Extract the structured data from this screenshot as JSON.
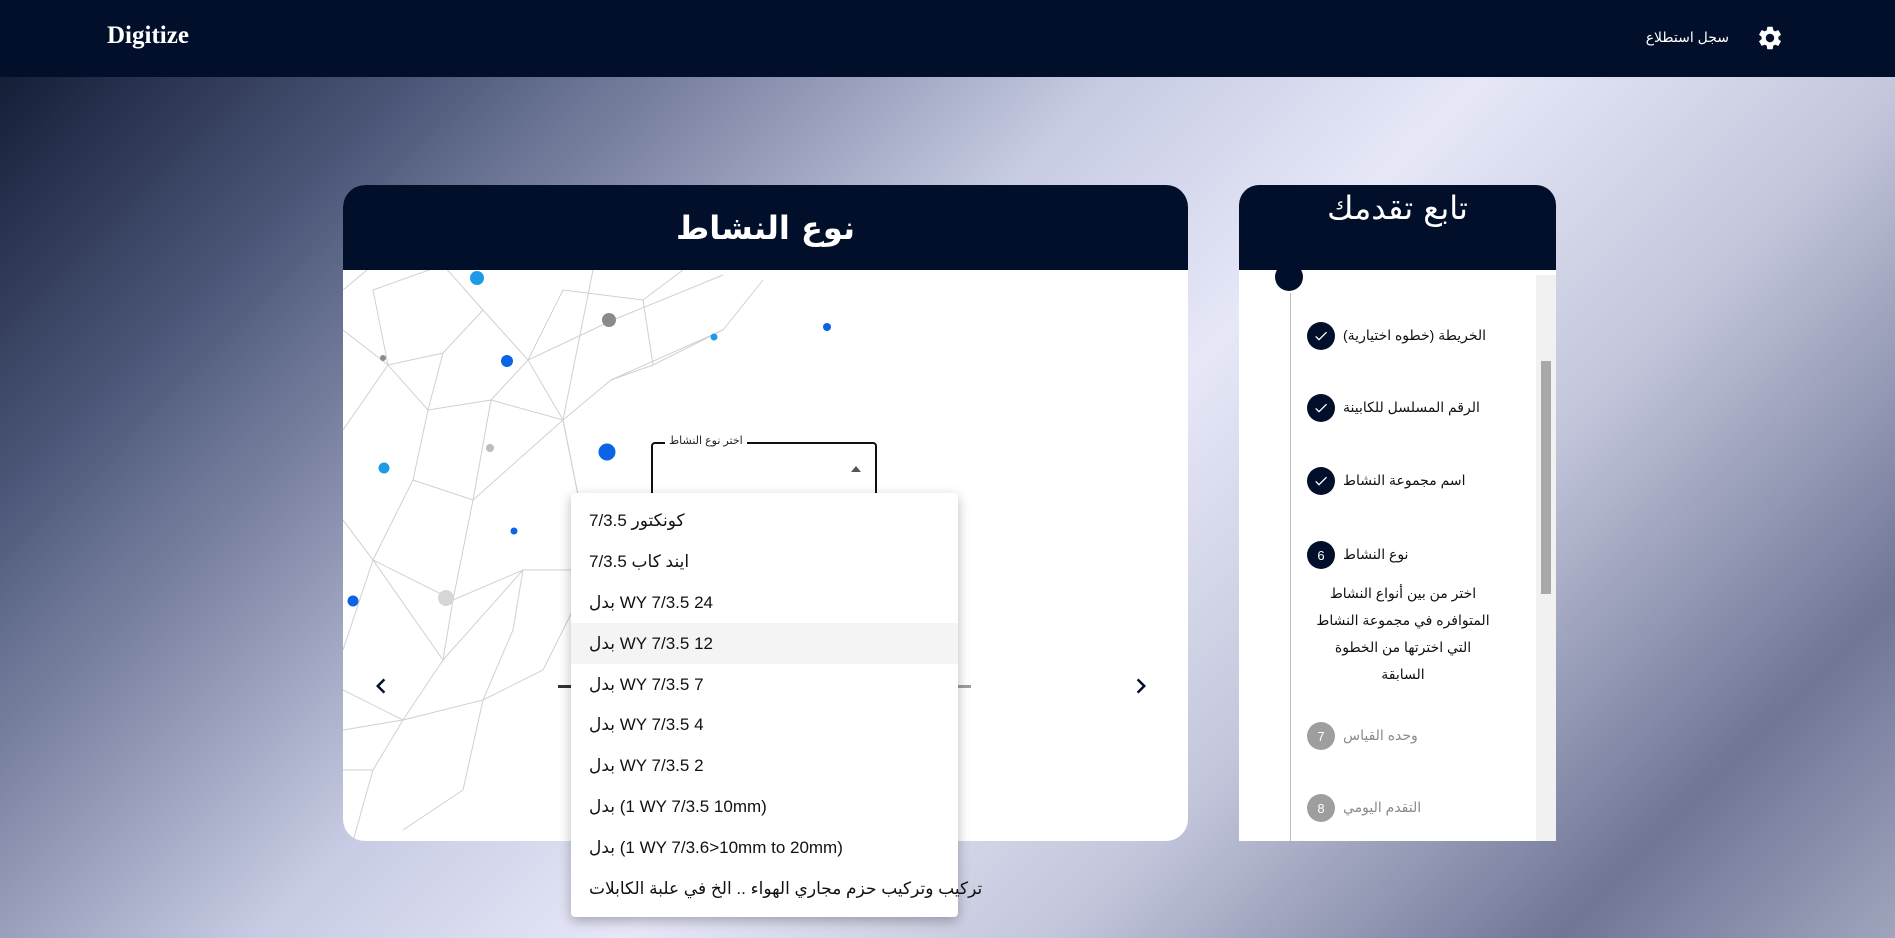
{
  "header": {
    "brand": "Digitize",
    "survey_link": "سجل استطلاع",
    "settings_icon": "gear-icon"
  },
  "main_card": {
    "title": "نوع النشاط",
    "select_label": "اختر نوع النشاط",
    "prev_icon": "chevron-left-icon",
    "next_icon": "chevron-right-icon"
  },
  "dropdown": {
    "highlighted_index": 3,
    "options": [
      "كونكتور 7/3.5",
      "ايند كاب 7/3.5",
      "بدل WY 7/3.5 24",
      "بدل WY 7/3.5 12",
      "بدل WY 7/3.5 7",
      "بدل WY 7/3.5 4",
      "بدل WY 7/3.5 2",
      "بدل (1 WY 7/3.5 10mm)",
      "بدل (1 WY 7/3.6>10mm to 20mm)",
      "تركيب وتركيب حزم مجاري الهواء .. الخ في علبة الكابلات"
    ]
  },
  "progress": {
    "title": "تابع تقدمك",
    "steps": [
      {
        "label": "الخريطة (خطوه اختيارية)",
        "status": "done",
        "marker": "check-icon"
      },
      {
        "label": "الرقم المسلسل للكابينة",
        "status": "done",
        "marker": "check-icon"
      },
      {
        "label": "اسم مجموعة النشاط",
        "status": "done",
        "marker": "check-icon"
      },
      {
        "label": "نوع النشاط",
        "status": "active",
        "marker": "6"
      },
      {
        "label": "وحده القياس",
        "status": "pending",
        "marker": "7"
      },
      {
        "label": "التقدم اليومي",
        "status": "pending",
        "marker": "8"
      }
    ],
    "active_description": "اختر من بين أنواع النشاط المتوافره في مجموعة النشاط التي اخترتها من الخطوة السابقة"
  },
  "colors": {
    "navy": "#020f2a",
    "pending": "#9e9e9e",
    "dot_blue": "#0b63e5",
    "dot_light_blue": "#1e9be8"
  }
}
